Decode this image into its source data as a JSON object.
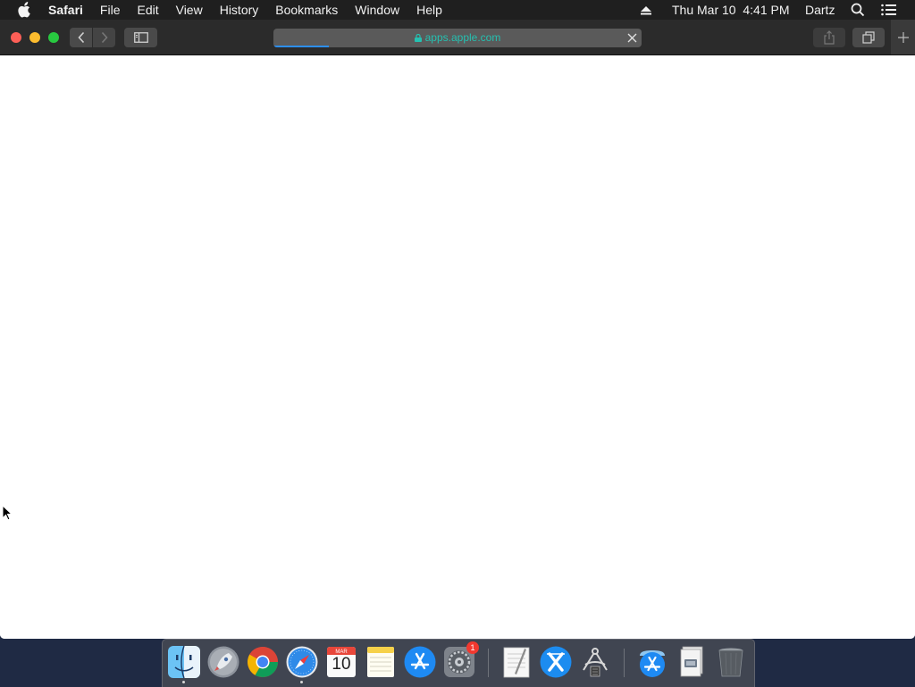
{
  "menubar": {
    "app_name": "Safari",
    "items": [
      "File",
      "Edit",
      "View",
      "History",
      "Bookmarks",
      "Window",
      "Help"
    ],
    "clock": "Thu Mar 10  4:41 PM",
    "user": "Dartz",
    "icons": [
      "apple-icon",
      "eject-icon",
      "search-icon",
      "list-icon"
    ]
  },
  "browser": {
    "url": "apps.apple.com",
    "loading_progress": 0.15,
    "secure": true,
    "accent_color": "#2c8ef0",
    "url_color": "#25c0b0"
  },
  "dock": {
    "apps": [
      {
        "name": "Finder",
        "icon": "finder-icon",
        "running": true
      },
      {
        "name": "Launchpad",
        "icon": "launchpad-icon",
        "running": false
      },
      {
        "name": "Google Chrome",
        "icon": "chrome-icon",
        "running": false
      },
      {
        "name": "Safari",
        "icon": "safari-icon",
        "running": true
      },
      {
        "name": "Calendar",
        "icon": "calendar-icon",
        "running": false,
        "month": "MAR",
        "day": "10"
      },
      {
        "name": "Notes",
        "icon": "notes-icon",
        "running": false
      },
      {
        "name": "App Store",
        "icon": "app-store-icon",
        "running": false
      },
      {
        "name": "System Preferences",
        "icon": "system-preferences-icon",
        "running": false,
        "badge": "1"
      },
      {
        "name": "TextEdit",
        "icon": "textedit-icon",
        "running": false
      },
      {
        "name": "Xcode",
        "icon": "xcode-icon",
        "running": false
      },
      {
        "name": "Instruments",
        "icon": "instruments-icon",
        "running": false
      },
      {
        "name": "Applications",
        "icon": "applications-folder-icon",
        "running": false
      },
      {
        "name": "Downloads",
        "icon": "downloads-stack-icon",
        "running": false
      },
      {
        "name": "Trash",
        "icon": "trash-icon",
        "running": false
      }
    ]
  }
}
